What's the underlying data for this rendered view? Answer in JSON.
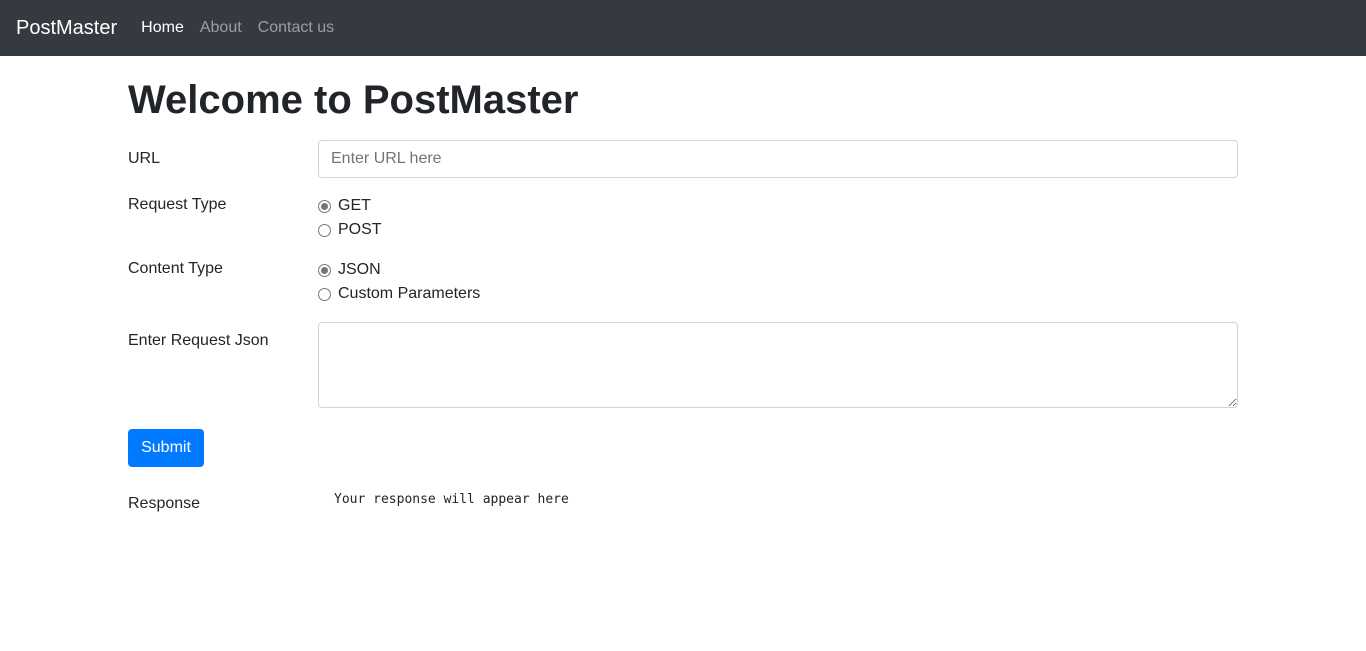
{
  "navbar": {
    "brand": "PostMaster",
    "links": [
      {
        "label": "Home"
      },
      {
        "label": "About"
      },
      {
        "label": "Contact us"
      }
    ]
  },
  "page": {
    "title": "Welcome to PostMaster"
  },
  "form": {
    "url": {
      "label": "URL",
      "placeholder": "Enter URL here",
      "value": ""
    },
    "request_type": {
      "label": "Request Type",
      "options": [
        {
          "label": "GET",
          "checked": true
        },
        {
          "label": "POST",
          "checked": false
        }
      ]
    },
    "content_type": {
      "label": "Content Type",
      "options": [
        {
          "label": "JSON",
          "checked": true
        },
        {
          "label": "Custom Parameters",
          "checked": false
        }
      ]
    },
    "request_json": {
      "label": "Enter Request Json",
      "value": ""
    },
    "submit_label": "Submit",
    "response": {
      "label": "Response",
      "text": "Your response will appear here"
    }
  },
  "colors": {
    "navbar_bg": "#343a40",
    "primary": "#007bff",
    "text": "#212529"
  }
}
